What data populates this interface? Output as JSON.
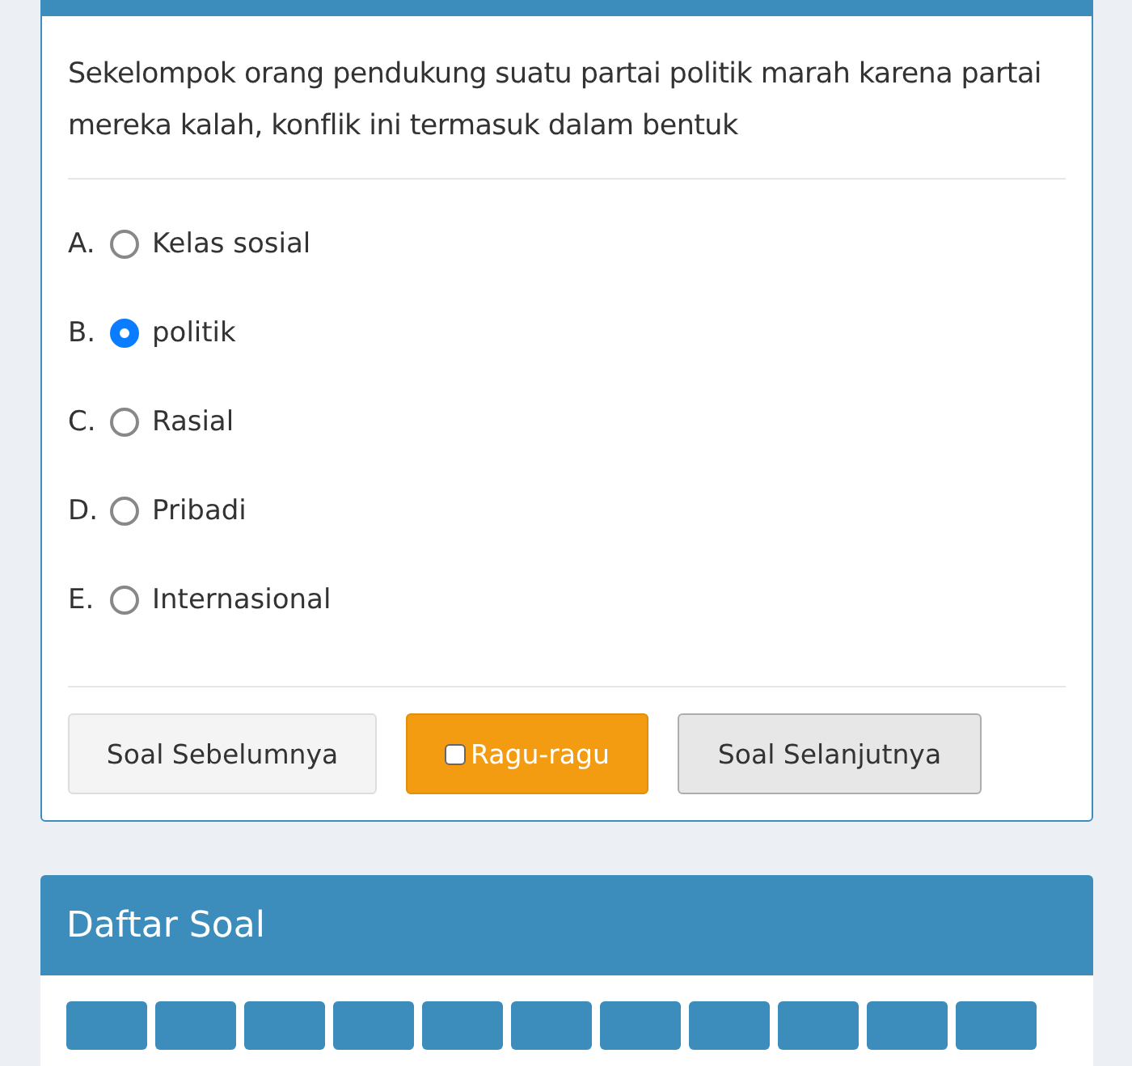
{
  "question": {
    "text": "Sekelompok orang pendukung suatu partai politik marah karena partai mereka kalah, konflik ini termasuk dalam bentuk"
  },
  "options": [
    {
      "letter": "A.",
      "label": "Kelas sosial",
      "selected": false
    },
    {
      "letter": "B.",
      "label": "politik",
      "selected": true
    },
    {
      "letter": "C.",
      "label": "Rasial",
      "selected": false
    },
    {
      "letter": "D.",
      "label": "Pribadi",
      "selected": false
    },
    {
      "letter": "E.",
      "label": "Internasional",
      "selected": false
    }
  ],
  "buttons": {
    "previous": "Soal Sebelumnya",
    "doubt": {
      "label": "Ragu-ragu",
      "checked": false
    },
    "next": "Soal Selanjutnya"
  },
  "question_list": {
    "title": "Daftar Soal"
  }
}
